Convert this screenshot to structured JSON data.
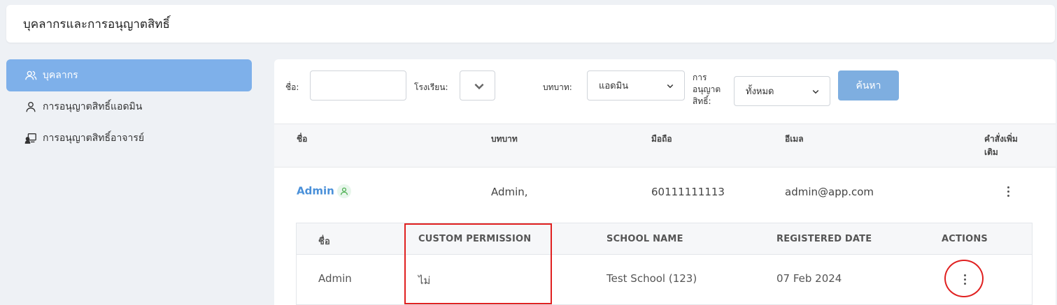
{
  "header": {
    "title": "บุคลากรและการอนุญาตสิทธิ์"
  },
  "sidebar": {
    "items": [
      {
        "label": "บุคลากร",
        "icon": "users-icon",
        "active": true
      },
      {
        "label": "การอนุญาตสิทธิ์แอดมิน",
        "icon": "user-icon",
        "active": false
      },
      {
        "label": "การอนุญาตสิทธิ์อาจารย์",
        "icon": "teacher-icon",
        "active": false
      }
    ]
  },
  "filters": {
    "name_label": "ชื่อ:",
    "name_value": "",
    "school_label": "โรงเรียน:",
    "school_value": "",
    "role_label": "บทบาท:",
    "role_value": "แอดมิน",
    "permission_label_line1": "การ",
    "permission_label_line2": "อนุญาต",
    "permission_label_line3": "สิทธิ์:",
    "permission_value": "ทั้งหมด",
    "search_label": "ค้นหา"
  },
  "table": {
    "columns": [
      "ชื่อ",
      "บทบาท",
      "มือถือ",
      "อีเมล",
      "คำสั่งเพิ่ม",
      "เติม"
    ],
    "rows": [
      {
        "name": "Admin",
        "role": "Admin,",
        "phone": "60111111113",
        "email": "admin@app.com"
      }
    ]
  },
  "subtable": {
    "columns": [
      "ชื่อ",
      "CUSTOM PERMISSION",
      "SCHOOL NAME",
      "REGISTERED DATE",
      "ACTIONS"
    ],
    "rows": [
      {
        "name": "Admin",
        "custom_permission": "ไม่",
        "school_name": "Test School (123)",
        "registered_date": "07 Feb 2024"
      }
    ]
  },
  "colors": {
    "accent": "#7eb0ea",
    "link": "#4a90d9",
    "highlight": "#e02020",
    "status_ok": "#4caf50"
  }
}
